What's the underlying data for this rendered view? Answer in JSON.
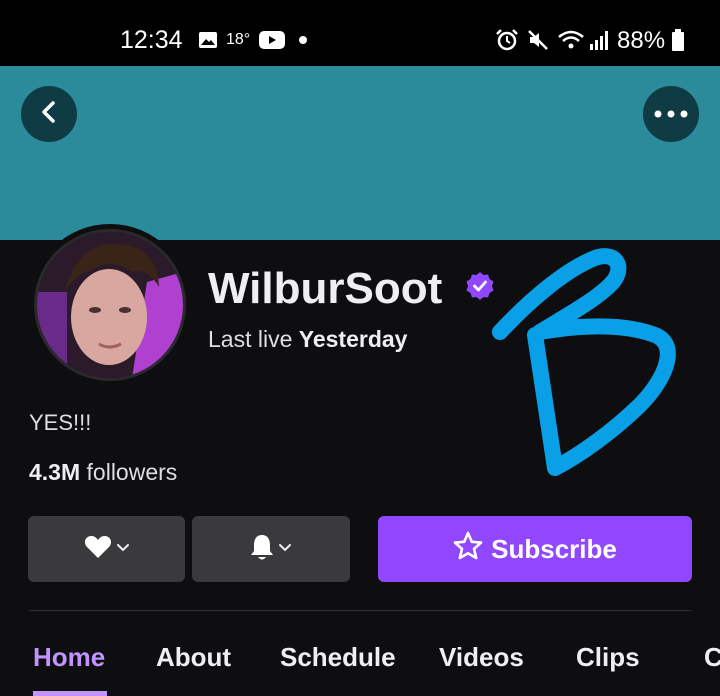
{
  "status_bar": {
    "time": "12:34",
    "temperature": "18°",
    "battery": "88%"
  },
  "header": {
    "back_icon": "chevron-left-icon",
    "more_icon": "more-horizontal-icon",
    "banner_color": "#2b8b9b"
  },
  "profile": {
    "channel_name": "WilburSoot",
    "verified": true,
    "last_live_prefix": "Last live",
    "last_live_value": "Yesterday",
    "bio": "YES!!!",
    "followers_count": "4.3M",
    "followers_label": "followers"
  },
  "actions": {
    "follow_icon": "heart-icon",
    "notify_icon": "bell-icon",
    "subscribe_label": "Subscribe",
    "subscribe_icon": "star-icon",
    "accent": "#9147ff"
  },
  "tabs": [
    {
      "label": "Home",
      "active": true
    },
    {
      "label": "About",
      "active": false
    },
    {
      "label": "Schedule",
      "active": false
    },
    {
      "label": "Videos",
      "active": false
    },
    {
      "label": "Clips",
      "active": false
    },
    {
      "label": "C",
      "active": false
    }
  ]
}
